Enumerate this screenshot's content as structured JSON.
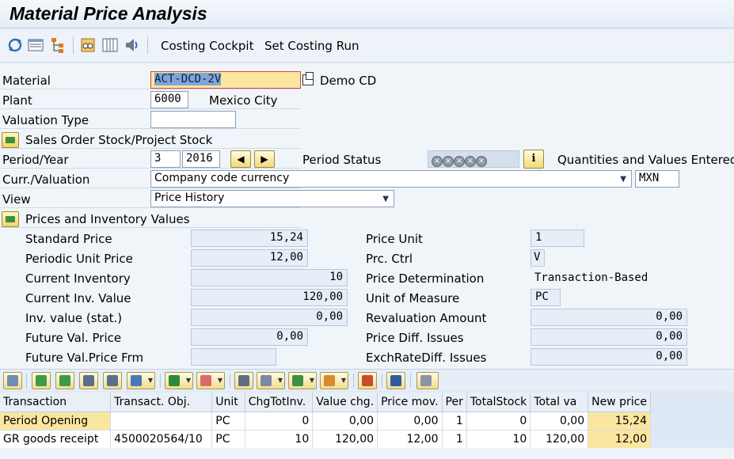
{
  "window": {
    "title": "Material Price Analysis"
  },
  "toolbar": {
    "icons": [
      "refresh-icon",
      "display-list-icon",
      "hierarchy-icon",
      "glasses-icon",
      "columns-icon",
      "speaker-icon"
    ],
    "costing_cockpit": "Costing Cockpit",
    "set_costing_run": "Set Costing Run"
  },
  "header": {
    "material_label": "Material",
    "material_value": "ACT-DCD-2V",
    "material_desc": "Demo CD",
    "plant_label": "Plant",
    "plant_value": "6000",
    "plant_desc": "Mexico City",
    "valuation_type_label": "Valuation Type",
    "valuation_type_value": "",
    "sales_order_stock": "Sales Order Stock/Project Stock",
    "period_year_label": "Period/Year",
    "period_value": "3",
    "year_value": "2016",
    "period_status_label": "Period Status",
    "period_status_text": "Quantities and Values Entered",
    "curr_valuation_label": "Curr./Valuation",
    "curr_valuation_value": "Company code currency",
    "currency": "MXN",
    "view_label": "View",
    "view_value": "Price History"
  },
  "prices": {
    "section_title": "Prices and Inventory Values",
    "standard_price_label": "Standard Price",
    "standard_price": "15,24",
    "periodic_unit_price_label": "Periodic Unit Price",
    "periodic_unit_price": "12,00",
    "current_inventory_label": "Current Inventory",
    "current_inventory": "10",
    "current_inv_value_label": "Current Inv. Value",
    "current_inv_value": "120,00",
    "inv_value_stat_label": "Inv. value (stat.)",
    "inv_value_stat": "0,00",
    "future_val_price_label": "Future Val. Price",
    "future_val_price": "0,00",
    "future_val_price_frm_label": "Future Val.Price Frm",
    "future_val_price_frm": "",
    "price_unit_label": "Price Unit",
    "price_unit": "1",
    "prc_ctrl_label": "Prc. Ctrl",
    "prc_ctrl": "V",
    "price_determination_label": "Price Determination",
    "price_determination": "Transaction-Based",
    "unit_of_measure_label": "Unit of Measure",
    "unit_of_measure": "PC",
    "revaluation_amount_label": "Revaluation Amount",
    "revaluation_amount": "0,00",
    "price_diff_issues_label": "Price Diff. Issues",
    "price_diff_issues": "0,00",
    "exchratediff_issues_label": "ExchRateDiff. Issues",
    "exchratediff_issues": "0,00"
  },
  "table": {
    "columns": [
      "Transaction",
      "Transact. Obj.",
      "Unit",
      "ChgTotInv.",
      "Value chg.",
      "Price mov.",
      "Per",
      "TotalStock",
      "Total va",
      "New price"
    ],
    "rows": [
      [
        "Period Opening",
        "",
        "PC",
        "0",
        "0,00",
        "0,00",
        "1",
        "0",
        "0,00",
        "15,24"
      ],
      [
        "GR goods receipt",
        "4500020564/10",
        "PC",
        "10",
        "120,00",
        "12,00",
        "1",
        "10",
        "120,00",
        "12,00"
      ]
    ]
  },
  "colors": {
    "highlight": "#fbe6a0",
    "field_bg": "#e6eef7",
    "background": "#dfe9f5"
  }
}
